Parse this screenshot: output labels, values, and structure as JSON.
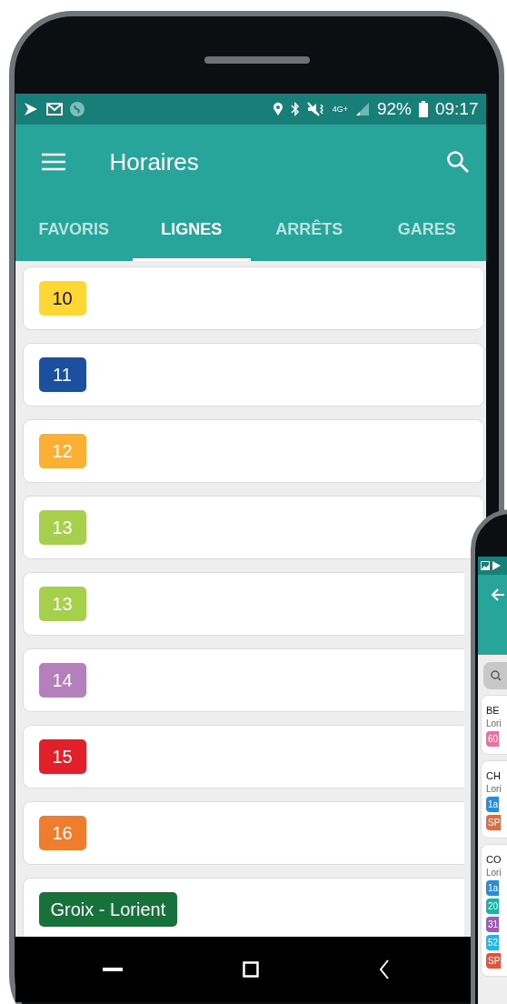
{
  "status_bar": {
    "network": "4G+",
    "battery": "92%",
    "time": "09:17"
  },
  "app_bar": {
    "title": "Horaires"
  },
  "tabs": [
    {
      "label": "FAVORIS",
      "selected": false
    },
    {
      "label": "LIGNES",
      "selected": true
    },
    {
      "label": "ARRÊTS",
      "selected": false
    },
    {
      "label": "GARES",
      "selected": false
    }
  ],
  "lines": [
    {
      "label": "10",
      "color": "#fdd835"
    },
    {
      "label": "11",
      "color": "#1c4fa0"
    },
    {
      "label": "12",
      "color": "#fbb034"
    },
    {
      "label": "13",
      "color": "#a6cf4c"
    },
    {
      "label": "13",
      "color": "#a6cf4c"
    },
    {
      "label": "14",
      "color": "#b57fbd"
    },
    {
      "label": "15",
      "color": "#e3202a"
    },
    {
      "label": "16",
      "color": "#ef7d2d"
    },
    {
      "label": "Groix - Lorient",
      "color": "#16713a"
    }
  ],
  "second_phone": {
    "stops": [
      {
        "name": "BE",
        "city": "Lori",
        "lines": [
          {
            "label": "60",
            "color": "#ec6fa3"
          }
        ]
      },
      {
        "name": "CH",
        "city": "Lori",
        "lines": [
          {
            "label": "1a",
            "color": "#2b8bd6"
          },
          {
            "label": "SP",
            "color": "#dd6c45"
          }
        ]
      },
      {
        "name": "CO",
        "city": "Lori",
        "lines": [
          {
            "label": "1a",
            "color": "#2b8bd6"
          },
          {
            "label": "20",
            "color": "#17b3a3"
          },
          {
            "label": "31",
            "color": "#9a5cb4"
          },
          {
            "label": "52",
            "color": "#22b6e6"
          },
          {
            "label": "SP",
            "color": "#e8523a"
          }
        ]
      }
    ]
  }
}
